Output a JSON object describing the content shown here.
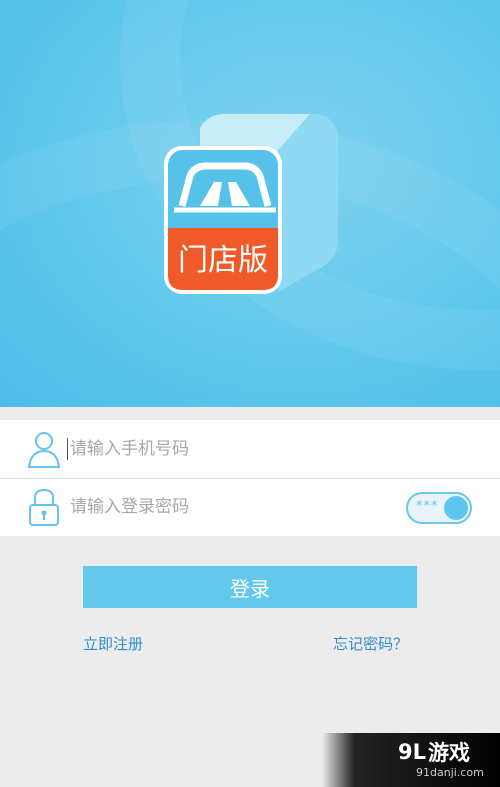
{
  "logo": {
    "badge_text": "门店版",
    "colors": {
      "cube": "#5cc4ea",
      "cube_light": "#bfe9f8",
      "badge": "#f05a28"
    }
  },
  "form": {
    "phone_placeholder": "请输入手机号码",
    "password_placeholder": "请输入登录密码",
    "password_toggle_dots": "***",
    "user_icon": "user-icon",
    "lock_icon": "lock-icon"
  },
  "actions": {
    "login_label": "登录",
    "register_label": "立即注册",
    "forgot_label": "忘记密码？"
  },
  "watermark": {
    "brand": "游戏",
    "brand_prefix": "9L",
    "site": "91danji.com"
  },
  "colors": {
    "hero": "#5ec7ec",
    "accent": "#63c8ec",
    "link": "#2f8ed0",
    "background": "#ececec"
  }
}
